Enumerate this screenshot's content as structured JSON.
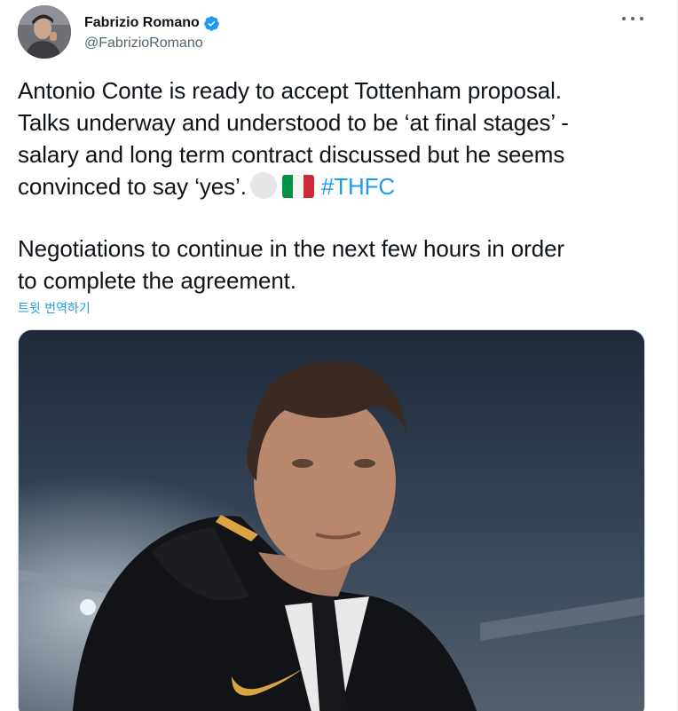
{
  "tweet": {
    "author": {
      "display_name": "Fabrizio Romano",
      "handle": "@FabrizioRomano",
      "verified": true,
      "avatar": "author-avatar"
    },
    "menu_icon": "more-icon",
    "text": {
      "line1": "Antonio Conte is ready to accept Tottenham proposal.",
      "line2": "Talks underway and understood to be ‘at final stages’ -",
      "line3": "salary and long term contract discussed but he seems",
      "line4": "convinced to say ‘yes’.",
      "emoji_1": "moon-emoji",
      "emoji_2": "italy-flag-emoji",
      "hashtag": "#THFC",
      "line5": "Negotiations to continue in the next few hours in order",
      "line6": "to complete the agreement."
    },
    "translate_label": "트윗 번역하기",
    "media": {
      "type": "photo",
      "subject": "man in black puffer jacket with gold swoosh logo, stadium floodlights background"
    }
  },
  "colors": {
    "link": "#1d9bf0",
    "text": "#0f1419",
    "secondary": "#536471",
    "verified": "#1d9bf0"
  }
}
